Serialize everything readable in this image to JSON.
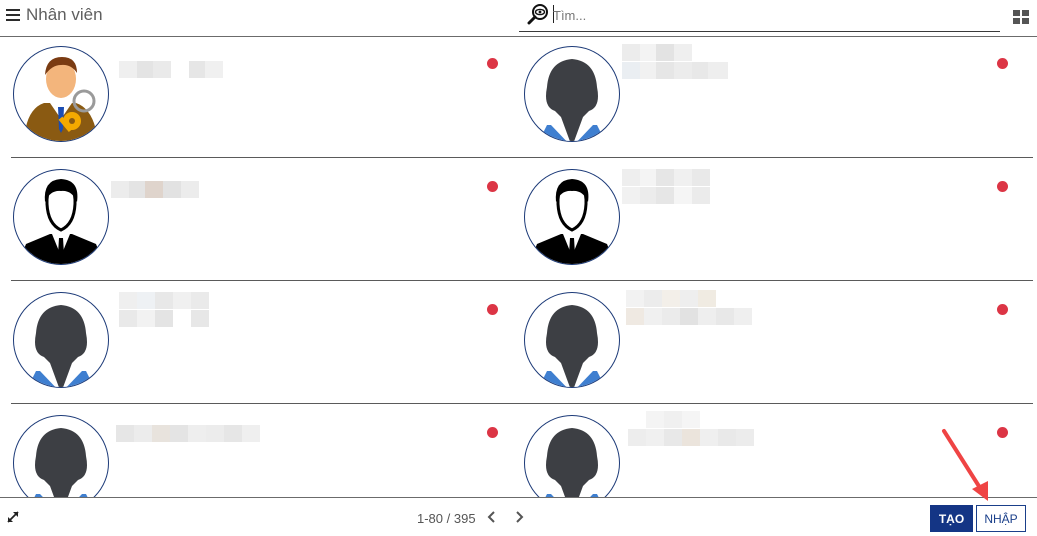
{
  "header": {
    "title": "Nhân viên",
    "search_placeholder": "Tìm..."
  },
  "employees": [
    {
      "avatar": "manager-with-keys",
      "status": "red"
    },
    {
      "avatar": "female-silhouette",
      "status": "red"
    },
    {
      "avatar": "male-suit-silhouette",
      "status": "red"
    },
    {
      "avatar": "male-suit-silhouette",
      "status": "red"
    },
    {
      "avatar": "female-silhouette",
      "status": "red"
    },
    {
      "avatar": "female-silhouette",
      "status": "red"
    },
    {
      "avatar": "female-silhouette",
      "status": "red"
    },
    {
      "avatar": "female-silhouette",
      "status": "red"
    }
  ],
  "footer": {
    "pager": "1-80 / 395",
    "create_label": "TẠO",
    "import_label": "NHẬP"
  },
  "colors": {
    "primary": "#143585",
    "status_red": "#dc3545",
    "avatar_border": "#1c3a78",
    "annotation_arrow": "#ef4444"
  }
}
